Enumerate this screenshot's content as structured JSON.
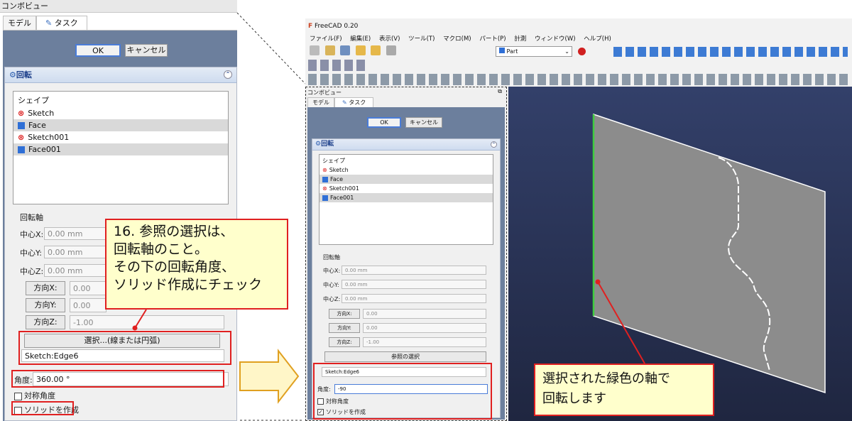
{
  "left_panel": {
    "title": "コンボビュー",
    "tabs": [
      "モデル",
      "タスク"
    ],
    "ok": "OK",
    "cancel": "キャンセル",
    "panel_title": "回転",
    "shapes_header": "シェイプ",
    "shapes": [
      "Sketch",
      "Face",
      "Sketch001",
      "Face001"
    ],
    "axis_header": "回転軸",
    "center_x_label": "中心X:",
    "center_y_label": "中心Y:",
    "center_z_label": "中心Z:",
    "center_x": "0.00 mm",
    "center_y": "0.00 mm",
    "center_z": "0.00 mm",
    "dir_x_label": "方向X:",
    "dir_y_label": "方向Y:",
    "dir_z_label": "方向Z:",
    "dir_x": "0.00",
    "dir_y": "0.00",
    "dir_z": "-1.00",
    "select_button": "選択...(線または円弧)",
    "edge_value": "Sketch:Edge6",
    "angle_label": "角度:",
    "angle_value": "360.00 °",
    "symmetric_label": "対称角度",
    "solid_label": "ソリッドを作成"
  },
  "callout_left": {
    "lines": [
      "16. 参照の選択は、",
      "回転軸のこと。",
      "その下の回転角度、",
      "ソリッド作成にチェック"
    ]
  },
  "freecad": {
    "title": "FreeCAD 0.20",
    "menu": [
      "ファイル(F)",
      "編集(E)",
      "表示(V)",
      "ツール(T)",
      "マクロ(M)",
      "パート(P)",
      "計測",
      "ウィンドウ(W)",
      "ヘルプ(H)"
    ],
    "workbench": "Part"
  },
  "right_panel": {
    "title": "コンボビュー",
    "tabs": [
      "モデル",
      "タスク"
    ],
    "ok": "OK",
    "cancel": "キャンセル",
    "panel_title": "回転",
    "shapes_header": "シェイプ",
    "shapes": [
      "Sketch",
      "Face",
      "Sketch001",
      "Face001"
    ],
    "axis_header": "回転軸",
    "center_x_label": "中心X:",
    "center_y_label": "中心Y:",
    "center_z_label": "中心Z:",
    "center_x": "0.00 mm",
    "center_y": "0.00 mm",
    "center_z": "0.00 mm",
    "dir_x_label": "方向X:",
    "dir_y_label": "方向Y:",
    "dir_z_label": "方向Z:",
    "dir_x": "0.00",
    "dir_y": "0.00",
    "dir_z": "-1.00",
    "select_button": "参照の選択",
    "edge_value": "Sketch:Edge6",
    "angle_label": "角度:",
    "angle_value": "-90",
    "symmetric_label": "対称角度",
    "solid_label": "ソリッドを作成",
    "solid_check": "✓"
  },
  "callout_right": {
    "lines": [
      "選択された緑色の軸で",
      "回転します"
    ]
  },
  "colors": {
    "accent_red": "#e02020",
    "callout_bg": "#ffffcc",
    "viewport_bg": "#2b3554",
    "face_fill": "#8c8c8c",
    "axis_green": "#3ecc3e"
  }
}
